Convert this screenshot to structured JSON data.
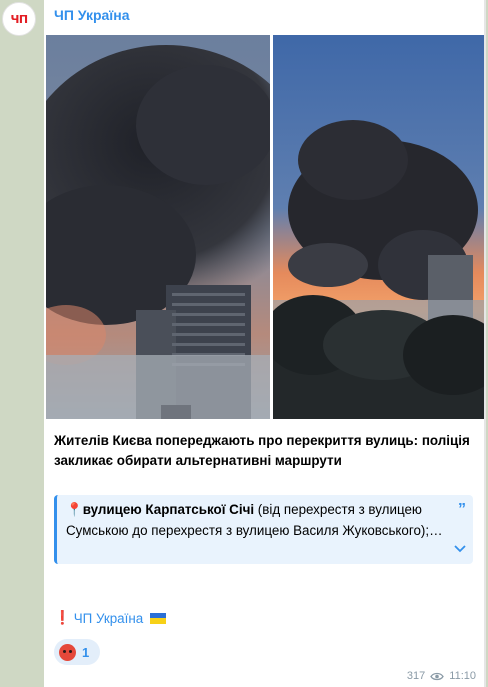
{
  "channel": {
    "name": "ЧП Україна",
    "avatar_text": "ЧП"
  },
  "post": {
    "headline": "Жителів Києва попереджають про перекриття вулиць: поліція закликає обирати альтернативні маршрути",
    "quote": {
      "pin": "📍",
      "street": "вулицею Карпатської Січі",
      "rest": " (від перехрестя з вулицею Сумською до перехрестя з вулицею Василя Жуковського);…"
    },
    "source_mark": "❗",
    "source_label": "ЧП Україна",
    "reaction_count": "1",
    "views": "317",
    "time": "11:10"
  },
  "icons": {
    "quote": "quote-mark-icon",
    "expand": "chevron-down-icon",
    "views": "eye-icon"
  },
  "colors": {
    "accent": "#3390ec",
    "brand": "#e31e24",
    "quote_bg": "#e9f3fd",
    "chat_bg": "#cfd8c4"
  }
}
